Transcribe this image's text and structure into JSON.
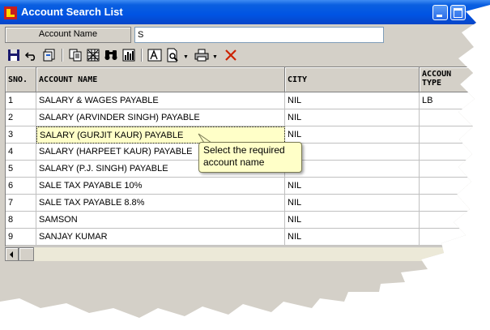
{
  "window": {
    "title": "Account Search List"
  },
  "search": {
    "label": "Account Name",
    "value": "S"
  },
  "toolbar": {
    "icons": [
      "save-icon",
      "undo-icon",
      "refresh-icon",
      "copy-icon",
      "grid-icon",
      "find-icon",
      "report-icon",
      "text-icon",
      "preview-icon",
      "print-icon",
      "delete-icon"
    ]
  },
  "table": {
    "headers": {
      "sno": "SNO.",
      "account_name": "ACCOUNT NAME",
      "city": "CITY",
      "type_line1": "ACCOUN",
      "type_line2": "TYPE"
    },
    "rows": [
      {
        "sno": "1",
        "name": "SALARY & WAGES PAYABLE",
        "city": "NIL",
        "type": "LB"
      },
      {
        "sno": "2",
        "name": "SALARY (ARVINDER SINGH) PAYABLE",
        "city": "NIL",
        "type": ""
      },
      {
        "sno": "3",
        "name": "SALARY (GURJIT KAUR) PAYABLE",
        "city": "NIL",
        "type": ""
      },
      {
        "sno": "4",
        "name": "SALARY (HARPEET KAUR) PAYABLE",
        "city": "",
        "type": ""
      },
      {
        "sno": "5",
        "name": "SALARY (P.J. SINGH) PAYABLE",
        "city": "",
        "type": ""
      },
      {
        "sno": "6",
        "name": "SALE TAX PAYABLE 10%",
        "city": "NIL",
        "type": ""
      },
      {
        "sno": "7",
        "name": "SALE TAX PAYABLE 8.8%",
        "city": "NIL",
        "type": ""
      },
      {
        "sno": "8",
        "name": "SAMSON",
        "city": "NIL",
        "type": ""
      },
      {
        "sno": "9",
        "name": "SANJAY KUMAR",
        "city": "NIL",
        "type": ""
      }
    ]
  },
  "tooltip": {
    "line1": "Select the required",
    "line2": "account name"
  },
  "colors": {
    "titlebar": "#0054e3",
    "selected_cell": "#ffffc8",
    "tooltip_bg": "#ffffc8",
    "delete_icon": "#cc2200"
  }
}
